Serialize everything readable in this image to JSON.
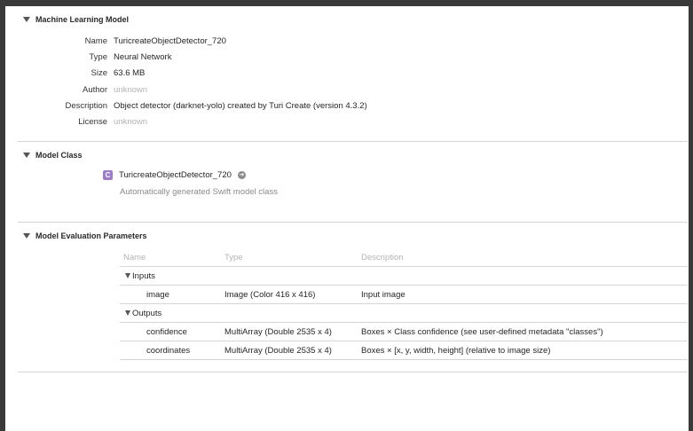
{
  "sections": {
    "machine_learning_model": {
      "title": "Machine Learning Model",
      "fields": [
        {
          "label": "Name",
          "value": "TuricreateObjectDetector_720"
        },
        {
          "label": "Type",
          "value": "Neural Network"
        },
        {
          "label": "Size",
          "value": "63.6 MB"
        },
        {
          "label": "Author",
          "value": "unknown"
        },
        {
          "label": "Description",
          "value": "Object detector (darknet-yolo) created by Turi Create (version 4.3.2)"
        },
        {
          "label": "License",
          "value": "unknown"
        }
      ]
    },
    "model_class": {
      "title": "Model Class",
      "badge": "C",
      "class_name": "TuricreateObjectDetector_720",
      "subtitle": "Automatically generated Swift model class"
    },
    "model_evaluation_parameters": {
      "title": "Model Evaluation Parameters",
      "columns": [
        "Name",
        "Type",
        "Description"
      ],
      "inputs_label": "Inputs",
      "outputs_label": "Outputs",
      "inputs": [
        {
          "name": "image",
          "type": "Image (Color 416 x 416)",
          "description": "Input image"
        }
      ],
      "outputs": [
        {
          "name": "confidence",
          "type": "MultiArray (Double 2535 x 4)",
          "description": "Boxes × Class confidence (see user-defined metadata \"classes\")"
        },
        {
          "name": "coordinates",
          "type": "MultiArray (Double 2535 x 4)",
          "description": "Boxes × [x, y, width, height] (relative to image size)"
        }
      ]
    }
  },
  "icons": {
    "disclosure": "disclosure-triangle-icon",
    "class": "class-badge-icon",
    "goto": "navigate-arrow-icon"
  },
  "colors": {
    "class_badge": "#9b7ec7",
    "muted_text": "#b3b3b3"
  }
}
